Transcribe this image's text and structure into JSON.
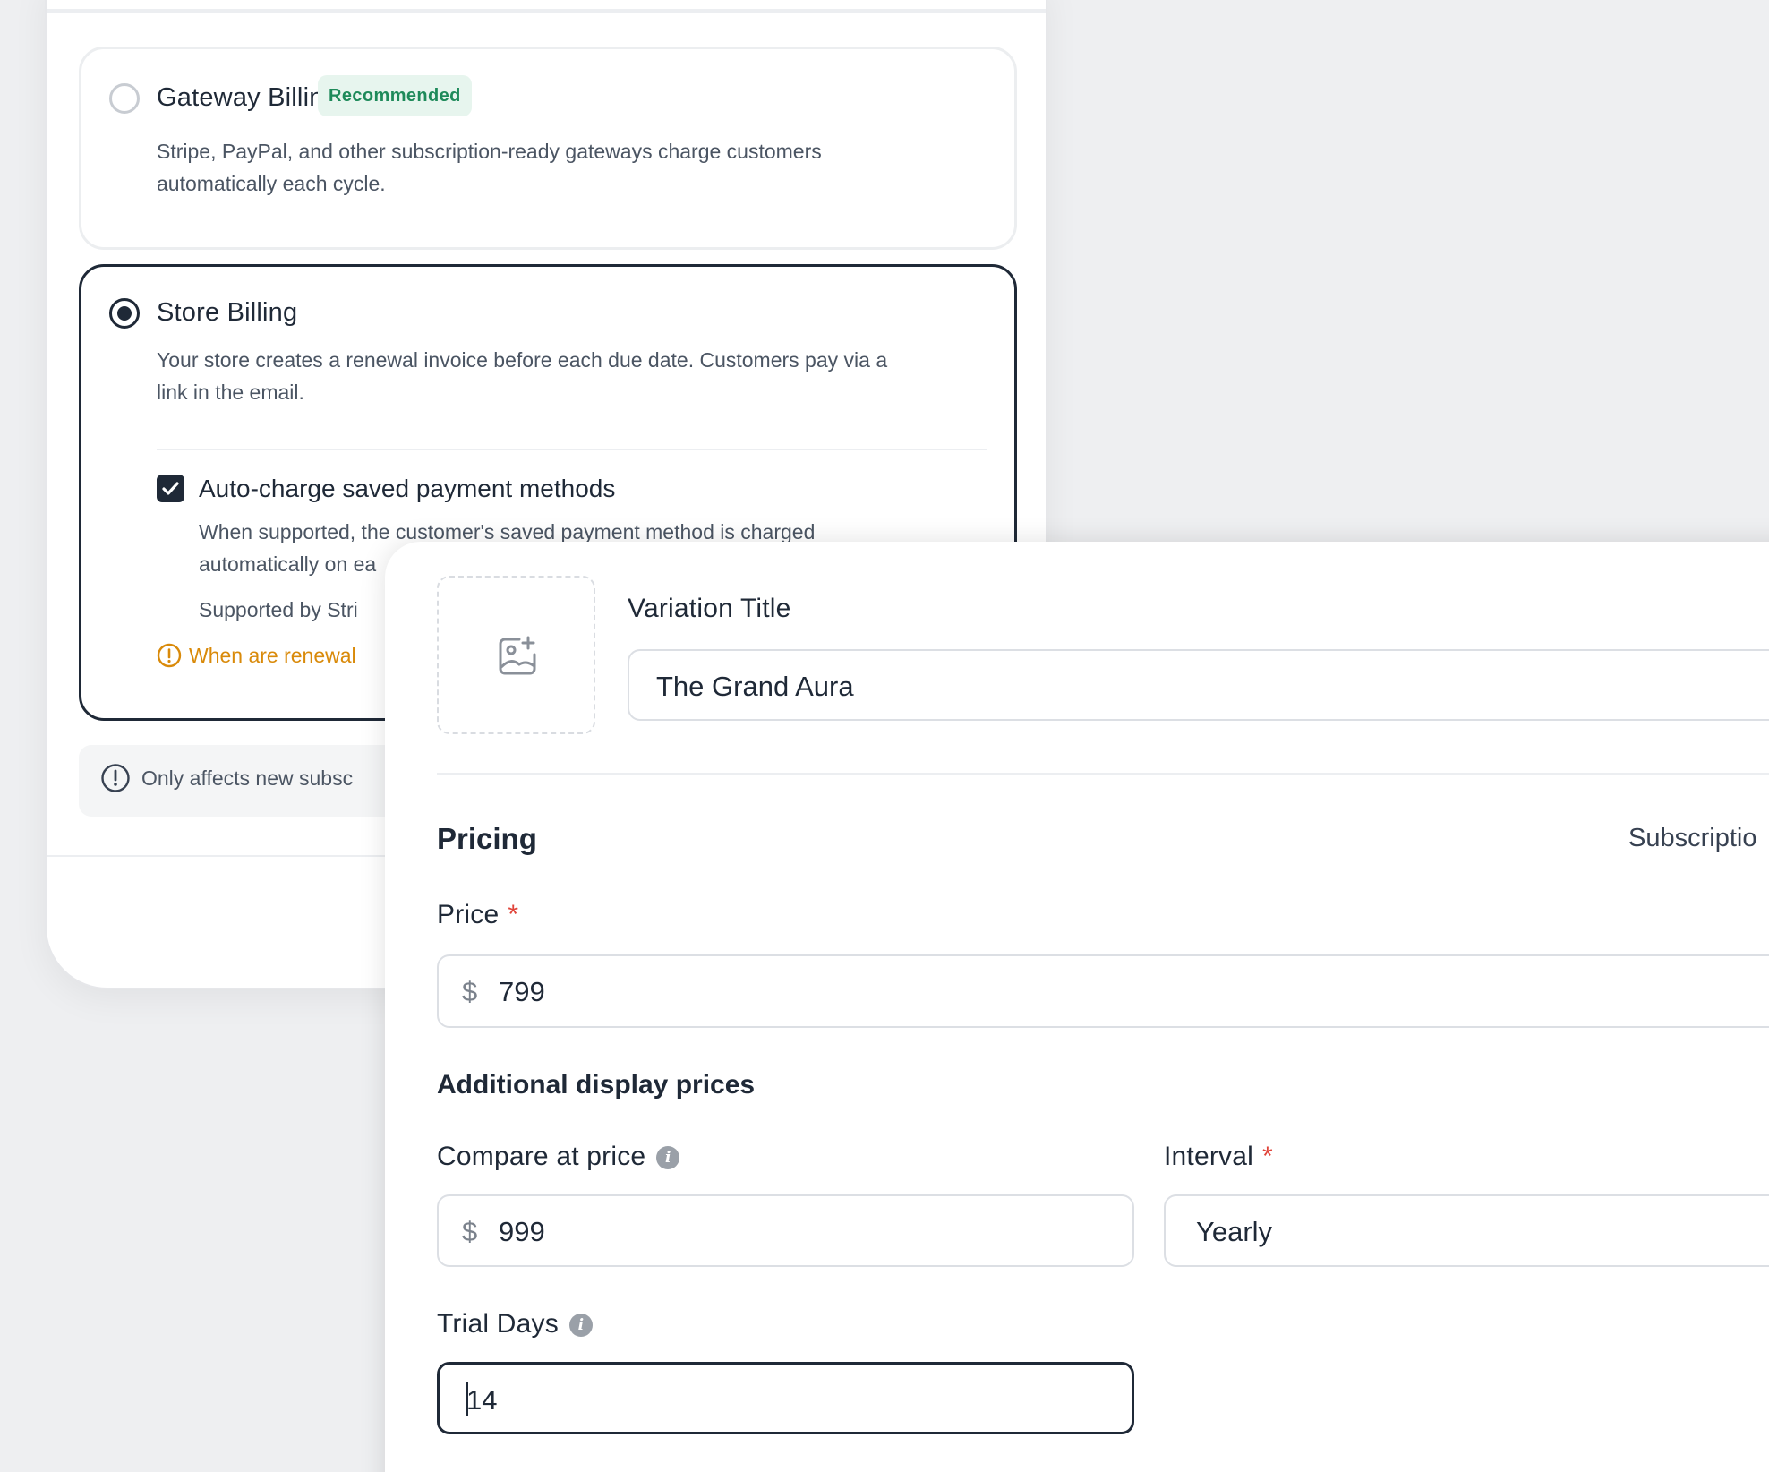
{
  "billing": {
    "gateway": {
      "title": "Gateway Billing",
      "badge": "Recommended",
      "desc_line1": "Stripe, PayPal, and other subscription-ready gateways charge customers",
      "desc_line2": "automatically each cycle.",
      "selected": false
    },
    "store": {
      "title": "Store Billing",
      "desc_line1": "Your store creates a renewal invoice before each due date. Customers pay via a",
      "desc_line2": "link in the email.",
      "selected": true,
      "autocharge": {
        "label": "Auto-charge saved payment methods",
        "checked": true,
        "desc_line1": "When supported, the customer's saved payment method is charged",
        "desc_line2": "automatically on ea",
        "supported": "Supported by Stri"
      },
      "warning_link": "When are renewal"
    },
    "notice": "Only affects new subsc"
  },
  "variation": {
    "title_label": "Variation Title",
    "title_value": "The Grand Aura",
    "pricing_heading": "Pricing",
    "pricing_right_label": "Subscriptio",
    "price_label": "Price",
    "required_mark": "*",
    "currency": "$",
    "price_value": "799",
    "additional_heading": "Additional display prices",
    "compare_label": "Compare at price",
    "compare_value": "999",
    "interval_label": "Interval",
    "interval_value": "Yearly",
    "trial_label": "Trial Days",
    "trial_value": "14",
    "info_glyph": "i"
  },
  "colors": {
    "accent_dark": "#1f2937",
    "badge_green": "#1e8a5a",
    "warning_orange": "#d98a0a",
    "required_red": "#e0443a"
  },
  "icons": [
    "image-upload-icon",
    "info-icon",
    "warning-icon",
    "checkmark-icon"
  ]
}
